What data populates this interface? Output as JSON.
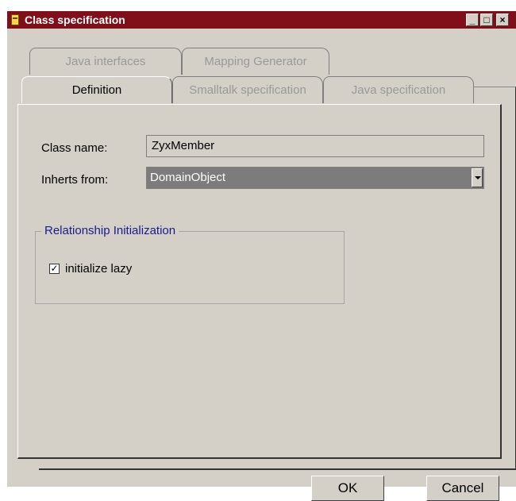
{
  "window": {
    "title": "Class specification",
    "controls": {
      "minimize": "_",
      "maximize": "□",
      "close": "×"
    }
  },
  "tabs": {
    "row_back": [
      "Java interfaces",
      "Mapping Generator"
    ],
    "row_front": [
      "Definition",
      "Smalltalk specification",
      "Java specification"
    ],
    "active": "Definition"
  },
  "form": {
    "class_name_label": "Class name:",
    "class_name_value": "ZyxMember",
    "inherits_label": "Inherts from:",
    "inherits_value": "DomainObject"
  },
  "relationship": {
    "legend": "Relationship Initialization",
    "initialize_lazy_label": "initialize lazy",
    "initialize_lazy_checked": true,
    "check_glyph": "✓"
  },
  "buttons": {
    "ok": "OK",
    "cancel": "Cancel"
  },
  "colors": {
    "titlebar": "#800f1a",
    "dialog_bg": "#d4d0c8",
    "group_legend": "#1a1a8c"
  }
}
